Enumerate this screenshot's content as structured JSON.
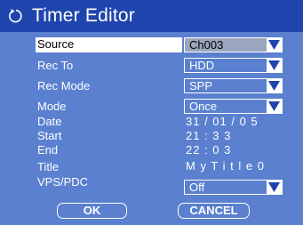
{
  "header": {
    "title": "Timer Editor",
    "icon": "timer-icon"
  },
  "rows": {
    "source": {
      "label": "Source",
      "value": "Ch003"
    },
    "rec_to": {
      "label": "Rec To",
      "value": "HDD"
    },
    "rec_mode": {
      "label": "Rec Mode",
      "value": "SPP"
    },
    "mode": {
      "label": "Mode",
      "value": "Once"
    },
    "date": {
      "label": "Date",
      "value": "31 / 01 / 0 5"
    },
    "start": {
      "label": "Start",
      "value": "21 : 3 3"
    },
    "end": {
      "label": "End",
      "value": "22 : 0 3"
    },
    "title": {
      "label": "Title",
      "value": "M y T i t l e 0"
    },
    "vps_pdc": {
      "label": "VPS/PDC",
      "value": "Off"
    }
  },
  "buttons": {
    "ok": "OK",
    "cancel": "CANCEL"
  },
  "colors": {
    "header": "#1f44ae",
    "panel": "#5a80cf",
    "selected_field": "#9aa6bd",
    "arrow": "#1f44ae"
  }
}
